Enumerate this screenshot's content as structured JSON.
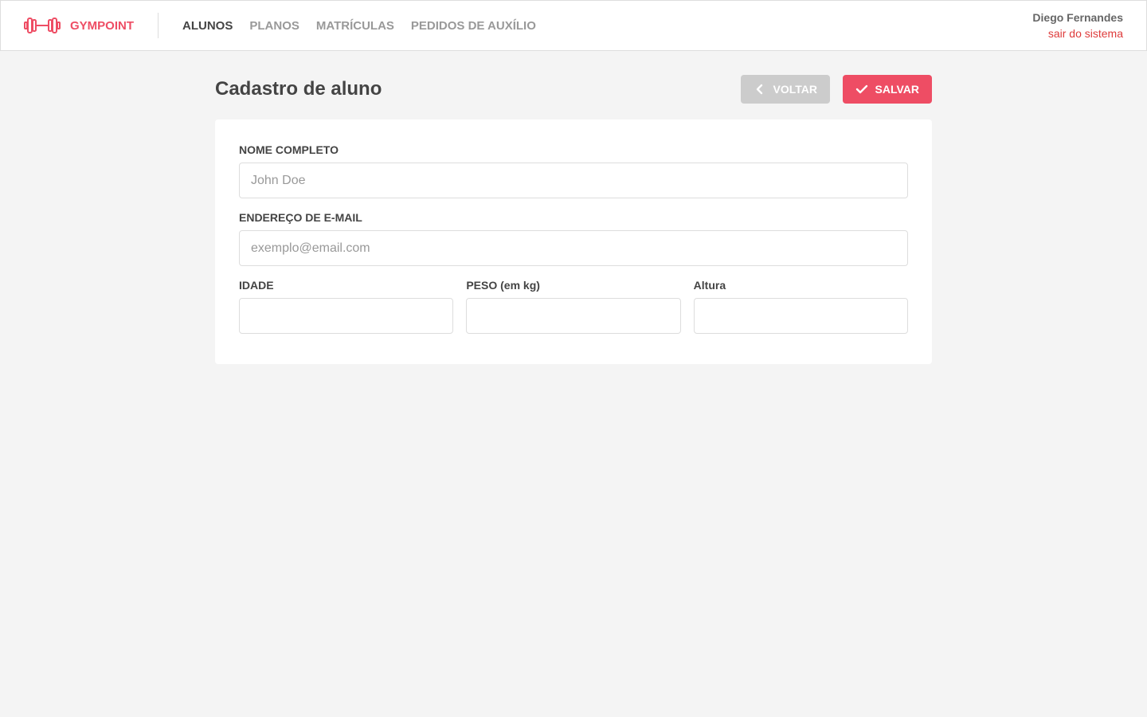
{
  "header": {
    "brand": "GYMPOINT",
    "nav": [
      {
        "label": "ALUNOS",
        "active": true
      },
      {
        "label": "PLANOS",
        "active": false
      },
      {
        "label": "MATRÍCULAS",
        "active": false
      },
      {
        "label": "PEDIDOS DE AUXÍLIO",
        "active": false
      }
    ],
    "user_name": "Diego Fernandes",
    "logout_label": "sair do sistema"
  },
  "page": {
    "title": "Cadastro de aluno",
    "back_label": "VOLTAR",
    "save_label": "SALVAR"
  },
  "form": {
    "name_label": "NOME COMPLETO",
    "name_placeholder": "John Doe",
    "email_label": "ENDEREÇO DE E-MAIL",
    "email_placeholder": "exemplo@email.com",
    "age_label": "IDADE",
    "weight_label": "PESO (em kg)",
    "height_label": "Altura"
  },
  "colors": {
    "accent": "#ee4d64",
    "logout": "#de3b3b",
    "back_button": "#cccccc",
    "background": "#f4f4f4"
  },
  "icons": {
    "brand": "dumbbell-icon",
    "back": "chevron-left-icon",
    "save": "check-icon"
  }
}
